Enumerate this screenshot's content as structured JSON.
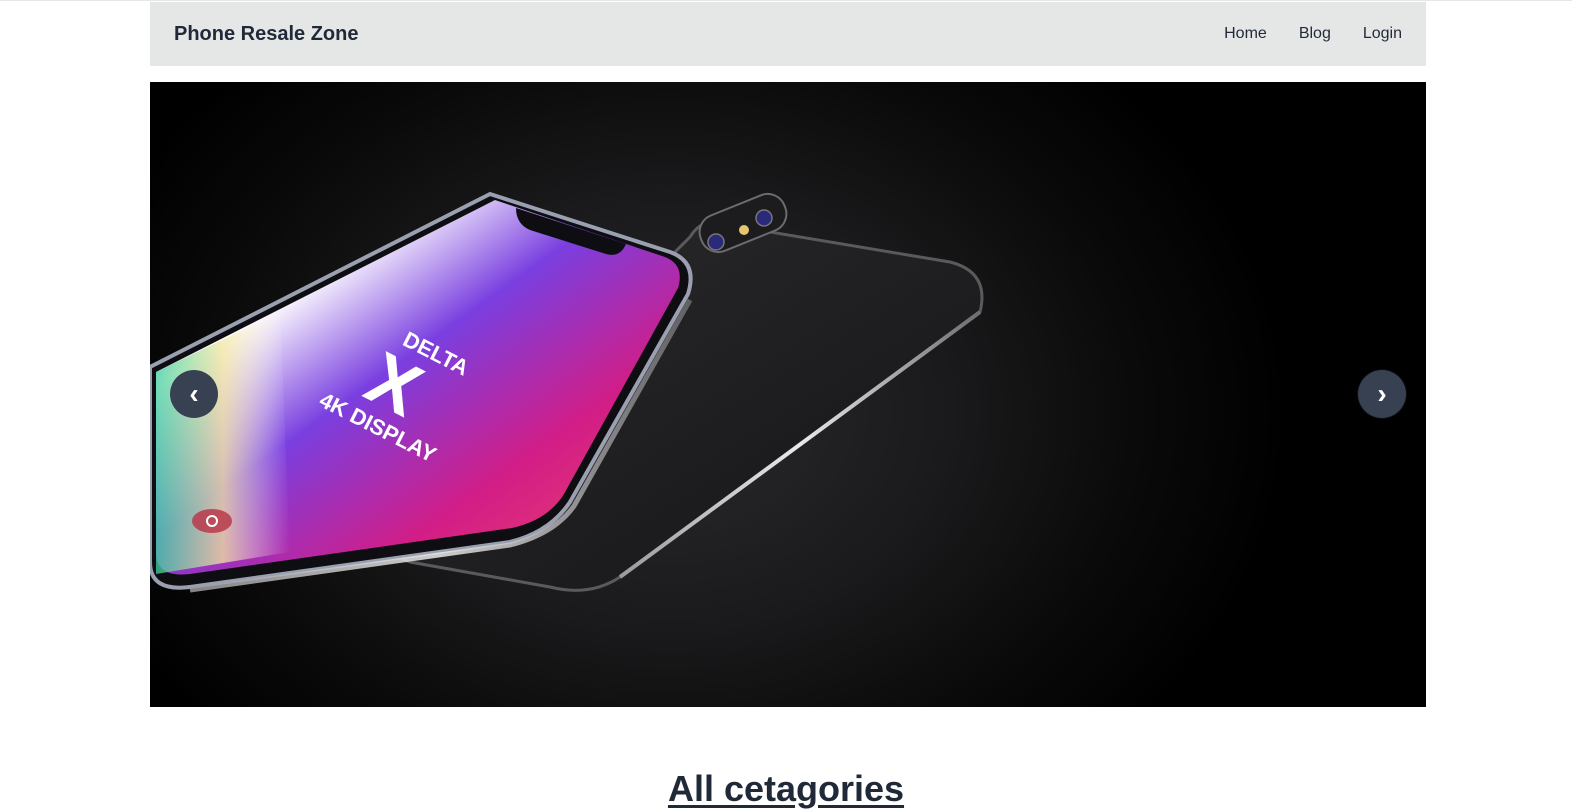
{
  "navbar": {
    "brand": "Phone Resale Zone",
    "links": [
      "Home",
      "Blog",
      "Login"
    ]
  },
  "carousel": {
    "prev_label": "‹",
    "next_label": "›",
    "image_description_text": {
      "screen_line1": "DELTA",
      "screen_line2": "X",
      "screen_line3": "4K DISPLAY"
    }
  },
  "section": {
    "title": "All cetagories"
  },
  "colors": {
    "navbar_bg": "#e5e7e7",
    "carousel_button_bg": "#374151",
    "text": "#1f2937"
  }
}
